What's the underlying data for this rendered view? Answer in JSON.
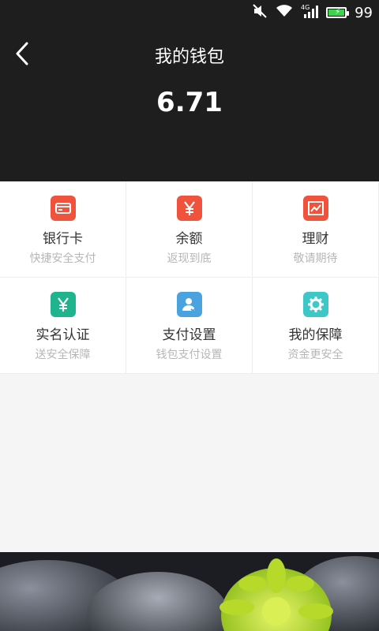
{
  "status_bar": {
    "battery_percent": "99",
    "icons": [
      "mute-icon",
      "wifi-icon",
      "signal-4g-icon",
      "battery-icon"
    ],
    "battery_color": "#39d449"
  },
  "header": {
    "title": "我的钱包",
    "balance": "6.71",
    "background": "#1e1e1e"
  },
  "grid": {
    "items": [
      {
        "title": "银行卡",
        "subtitle": "快捷安全支付",
        "icon": "bank-card-icon",
        "color": "#f0523b"
      },
      {
        "title": "余额",
        "subtitle": "返现到底",
        "icon": "yen-icon",
        "color": "#f0523b"
      },
      {
        "title": "理财",
        "subtitle": "敬请期待",
        "icon": "finance-chart-icon",
        "color": "#f0523b"
      },
      {
        "title": "实名认证",
        "subtitle": "送安全保障",
        "icon": "verify-yen-icon",
        "color": "#1fb38e"
      },
      {
        "title": "支付设置",
        "subtitle": "钱包支付设置",
        "icon": "user-settings-icon",
        "color": "#4aa3df"
      },
      {
        "title": "我的保障",
        "subtitle": "资金更安全",
        "icon": "gear-icon",
        "color": "#3ec7c7"
      }
    ]
  }
}
